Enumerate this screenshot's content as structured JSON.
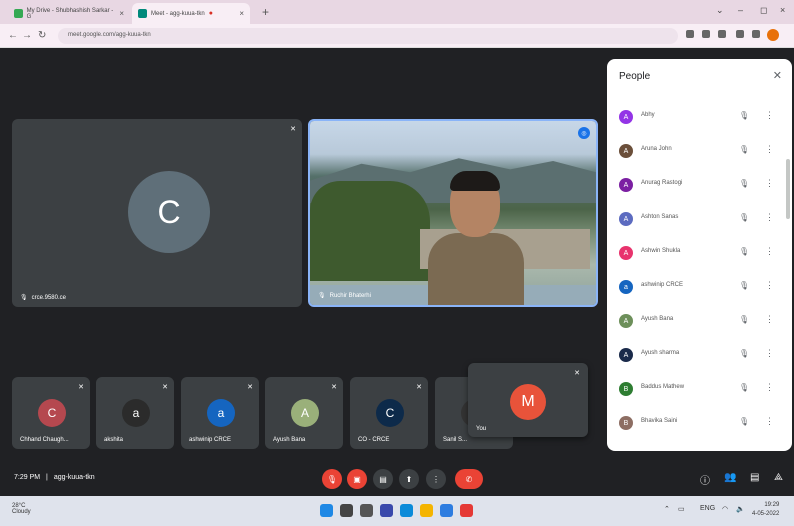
{
  "browser": {
    "tabs": [
      {
        "title": "My Drive - Shubhashish Sarkar - G",
        "active": false
      },
      {
        "title": "Meet - agg-kuua-tkn",
        "active": true
      }
    ],
    "url": "meet.google.com/agg-kuua-tkn"
  },
  "stage": {
    "main_tiles": [
      {
        "name": "crce.9580.ce",
        "initial": "C",
        "muted": true
      },
      {
        "name": "Ruchir Bhaterhi",
        "pinned": true
      }
    ],
    "small_tiles": [
      {
        "name": "Chhand Chaugh...",
        "initial": "C"
      },
      {
        "name": "akshita",
        "initial": "a"
      },
      {
        "name": "ashwinip CRCE",
        "initial": "a"
      },
      {
        "name": "Ayush Bana",
        "initial": "A"
      },
      {
        "name": "CO - CRCE",
        "initial": "C"
      },
      {
        "name": "Sanil S...",
        "initial": "S"
      }
    ],
    "floating_tile": {
      "name": "You",
      "initial": "M"
    }
  },
  "people_panel": {
    "title": "People",
    "participants": [
      {
        "name": "Abhy",
        "initial": "A",
        "color": "#9334e6"
      },
      {
        "name": "Aruna John",
        "initial": "A",
        "color": "#6b4f3a"
      },
      {
        "name": "Anurag Rastogi",
        "initial": "A",
        "color": "#7b1fa2"
      },
      {
        "name": "Ashton Sanas",
        "initial": "A",
        "color": "#5c6bc0"
      },
      {
        "name": "Ashwin Shukla",
        "initial": "A",
        "color": "#e8336d"
      },
      {
        "name": "ashwinip CRCE",
        "initial": "a",
        "color": "#1565c0"
      },
      {
        "name": "Ayush Bana",
        "initial": "A",
        "color": "#6d8f5a"
      },
      {
        "name": "Ayush sharma",
        "initial": "A",
        "color": "#1a2a4a"
      },
      {
        "name": "Baddus Mathew",
        "initial": "B",
        "color": "#2e7d32"
      },
      {
        "name": "Bhavika Saini",
        "initial": "B",
        "color": "#8d6e63"
      }
    ]
  },
  "bottom_bar": {
    "time": "7:29 PM",
    "meeting_code": "agg-kuua-tkn"
  },
  "taskbar": {
    "weather_temp": "28°C",
    "weather_desc": "Cloudy",
    "clock_time": "19:29",
    "clock_date": "4-05-2022"
  },
  "colors": {
    "accent": "#1a73e8",
    "danger": "#ea4335",
    "surface": "#3c4043",
    "background": "#202124"
  }
}
